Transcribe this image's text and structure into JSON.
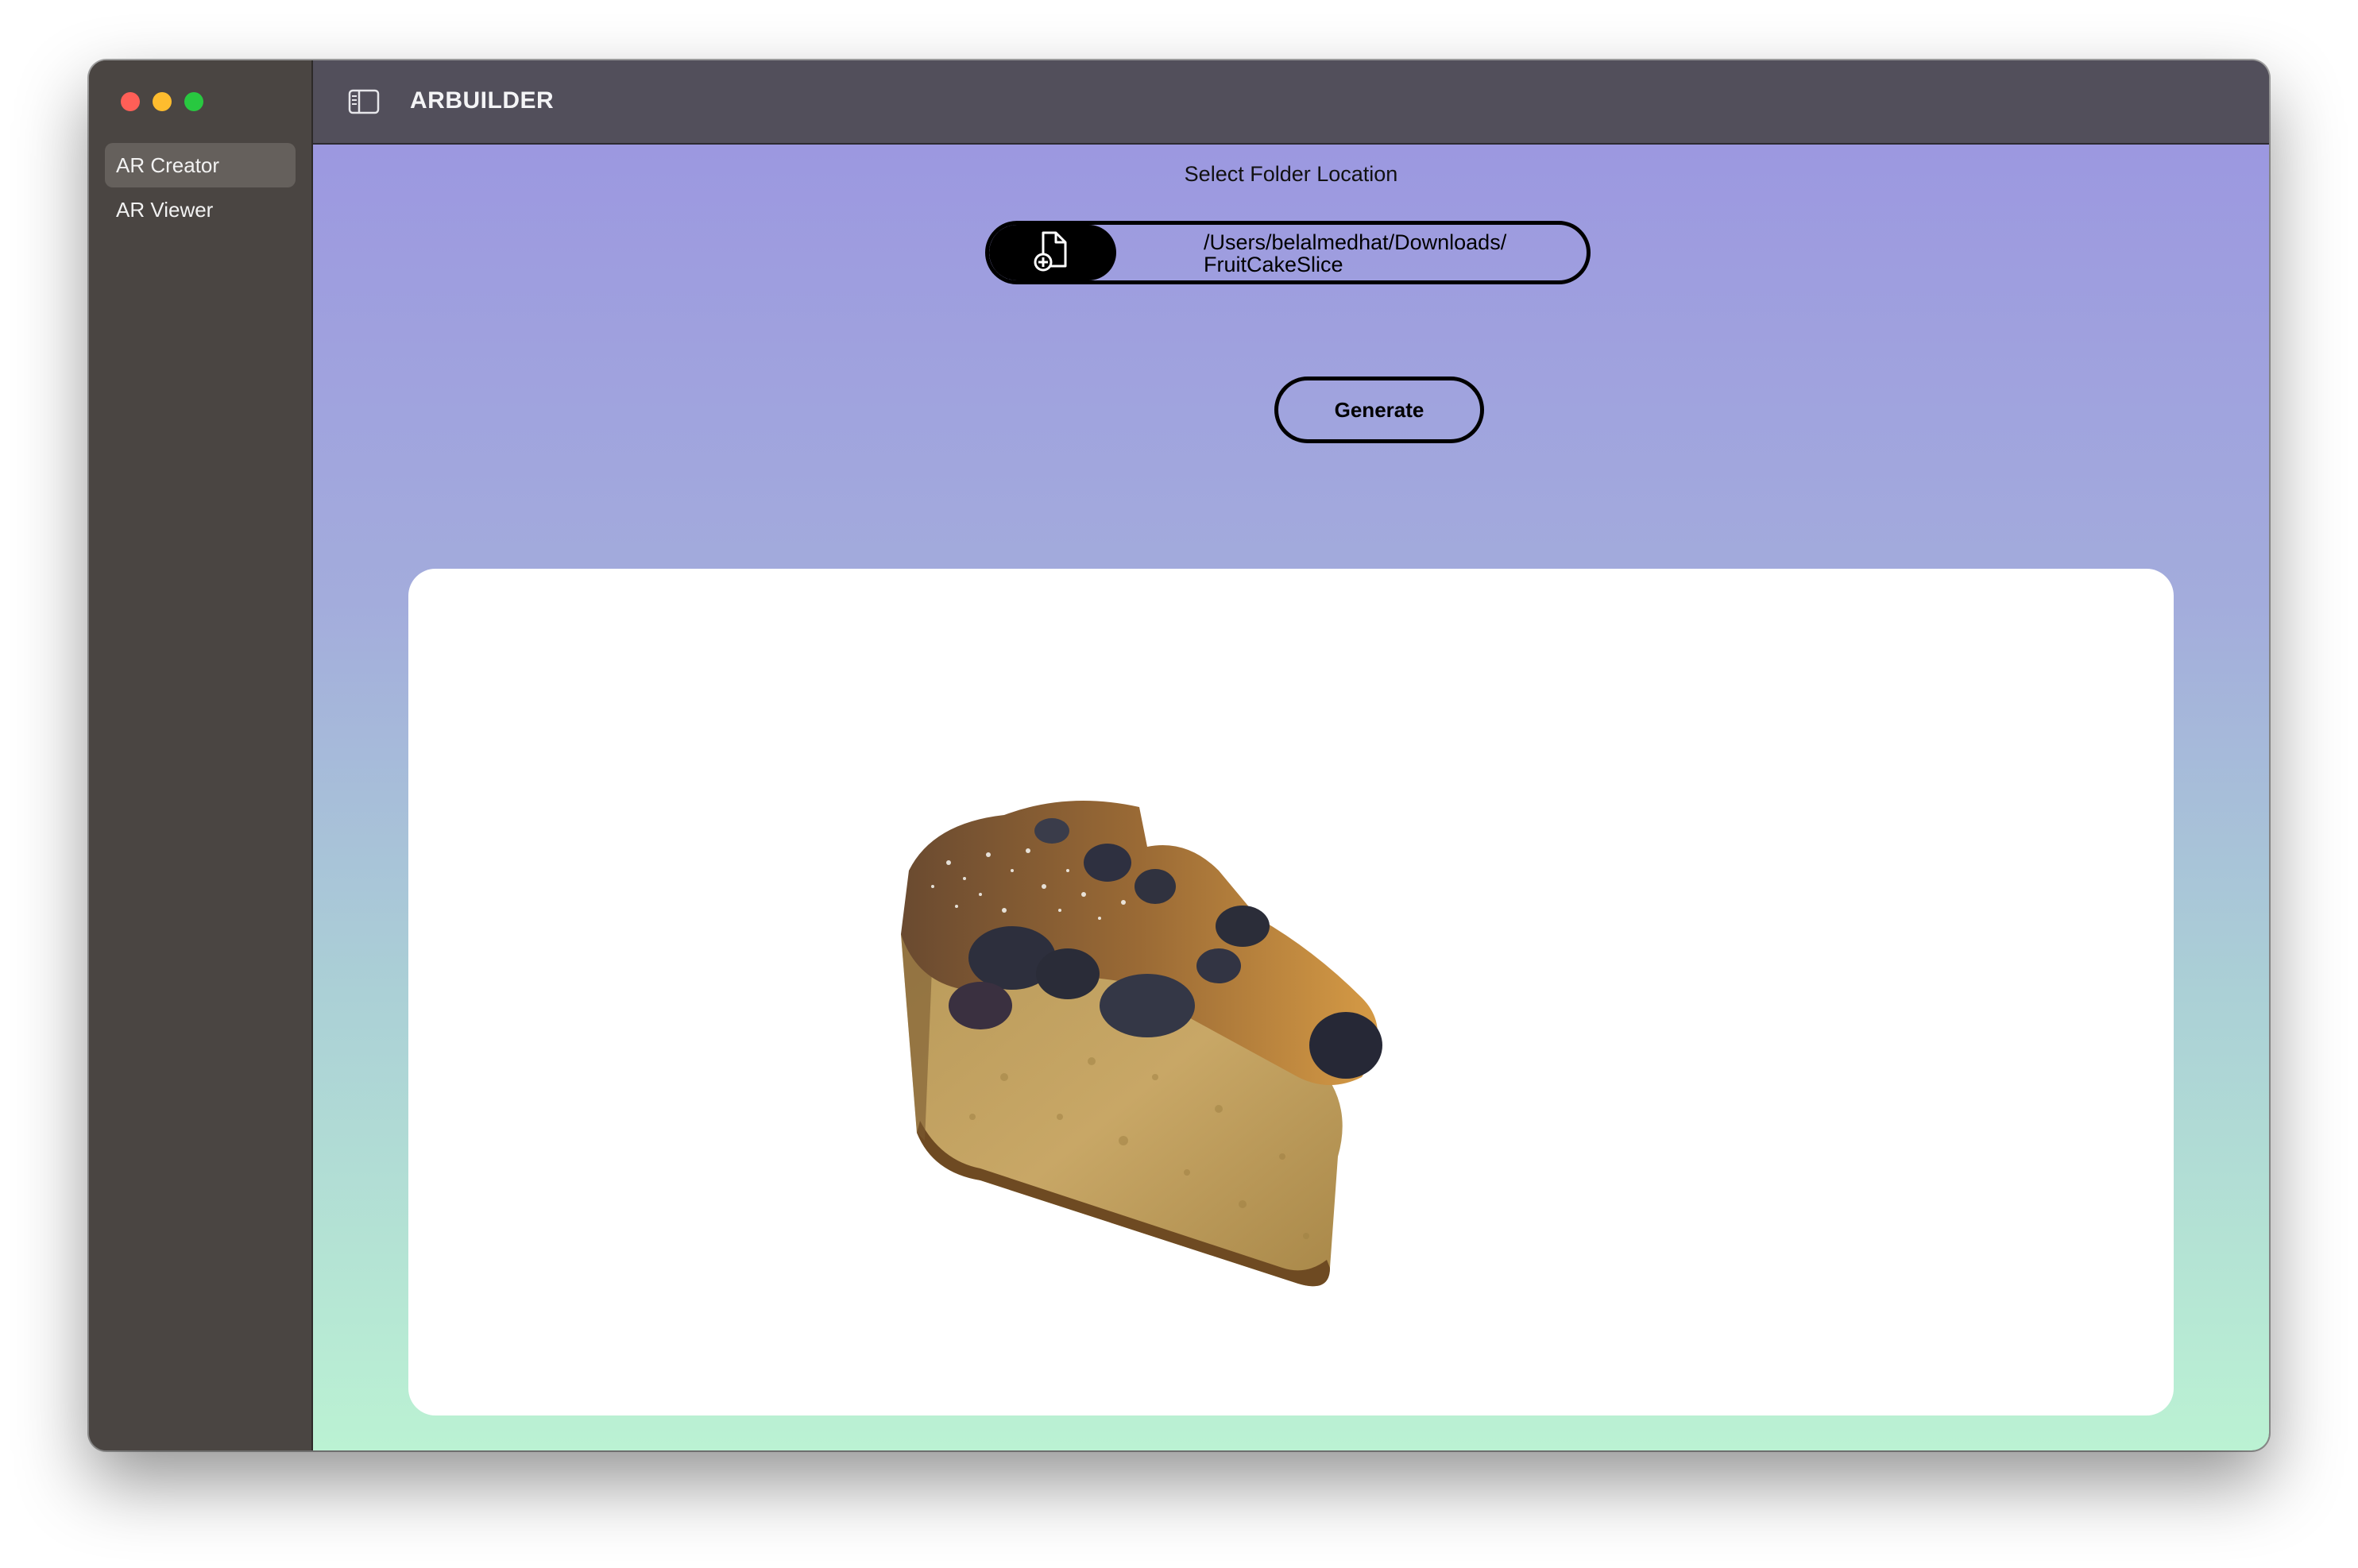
{
  "sidebar": {
    "items": [
      {
        "label": "AR Creator",
        "active": true
      },
      {
        "label": "AR Viewer",
        "active": false
      }
    ]
  },
  "titlebar": {
    "title": "ARBUILDER"
  },
  "main": {
    "folder_label": "Select Folder Location",
    "path_value": "/Users/belalmedhat/Downloads/\nFruitCakeSlice",
    "generate_label": "Generate"
  },
  "colors": {
    "sidebar_bg": "#4a4542",
    "titlebar_bg": "#524f5b",
    "gradient_top": "#9c98e0",
    "gradient_bottom": "#bbf2d3"
  },
  "icons": {
    "sidebar_toggle": "sidebar-toggle-icon",
    "add_file": "doc-badge-plus-icon"
  }
}
